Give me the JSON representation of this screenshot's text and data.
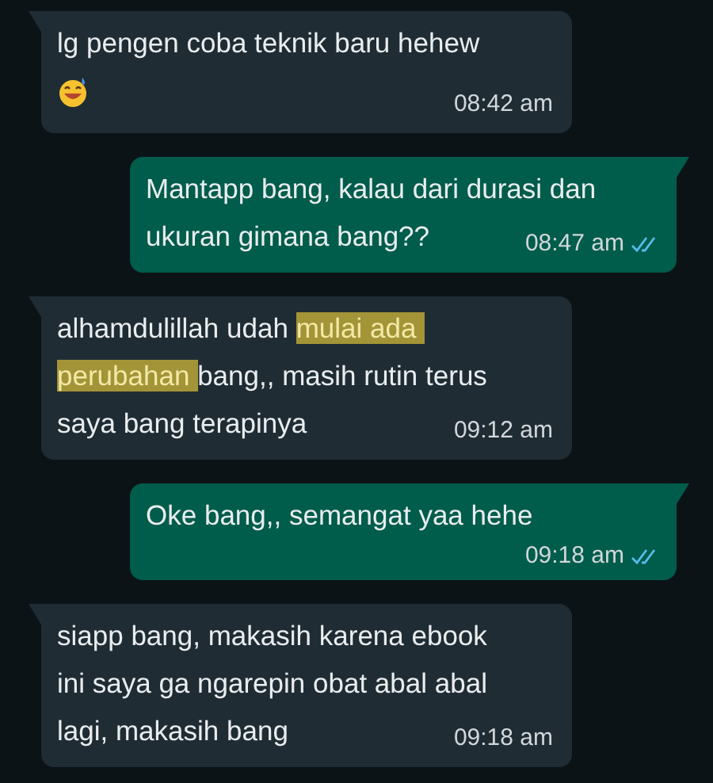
{
  "messages": [
    {
      "kind": "incoming",
      "lines": [
        [
          {
            "text": "lg pengen coba teknik baru hehew",
            "highlighted": false
          }
        ]
      ],
      "emoji": true,
      "time": "08:42 am"
    },
    {
      "kind": "outgoing",
      "lines": [
        [
          {
            "text": "Mantapp bang, kalau dari durasi dan",
            "highlighted": false
          }
        ],
        [
          {
            "text": "ukuran gimana bang??",
            "highlighted": false
          }
        ]
      ],
      "emoji": false,
      "time": "08:47 am",
      "read": true
    },
    {
      "kind": "incoming",
      "lines": [
        [
          {
            "text": "alhamdulillah udah ",
            "highlighted": false
          },
          {
            "text": "mulai ada ",
            "highlighted": true
          }
        ],
        [
          {
            "text": "perubahan ",
            "highlighted": true
          },
          {
            "text": "bang,, masih rutin terus",
            "highlighted": false
          }
        ],
        [
          {
            "text": "saya bang terapinya",
            "highlighted": false
          }
        ]
      ],
      "emoji": false,
      "time": "09:12 am"
    },
    {
      "kind": "outgoing",
      "lines": [
        [
          {
            "text": "Oke bang,, semangat yaa hehe",
            "highlighted": false
          }
        ]
      ],
      "emoji": false,
      "time": "09:18 am",
      "read": true
    },
    {
      "kind": "incoming",
      "lines": [
        [
          {
            "text": "siapp bang, makasih karena ebook",
            "highlighted": false
          }
        ],
        [
          {
            "text": "ini saya ga ngarepin obat abal abal",
            "highlighted": false
          }
        ],
        [
          {
            "text": "lagi, makasih bang",
            "highlighted": false
          }
        ]
      ],
      "emoji": false,
      "time": "09:18 am"
    }
  ]
}
